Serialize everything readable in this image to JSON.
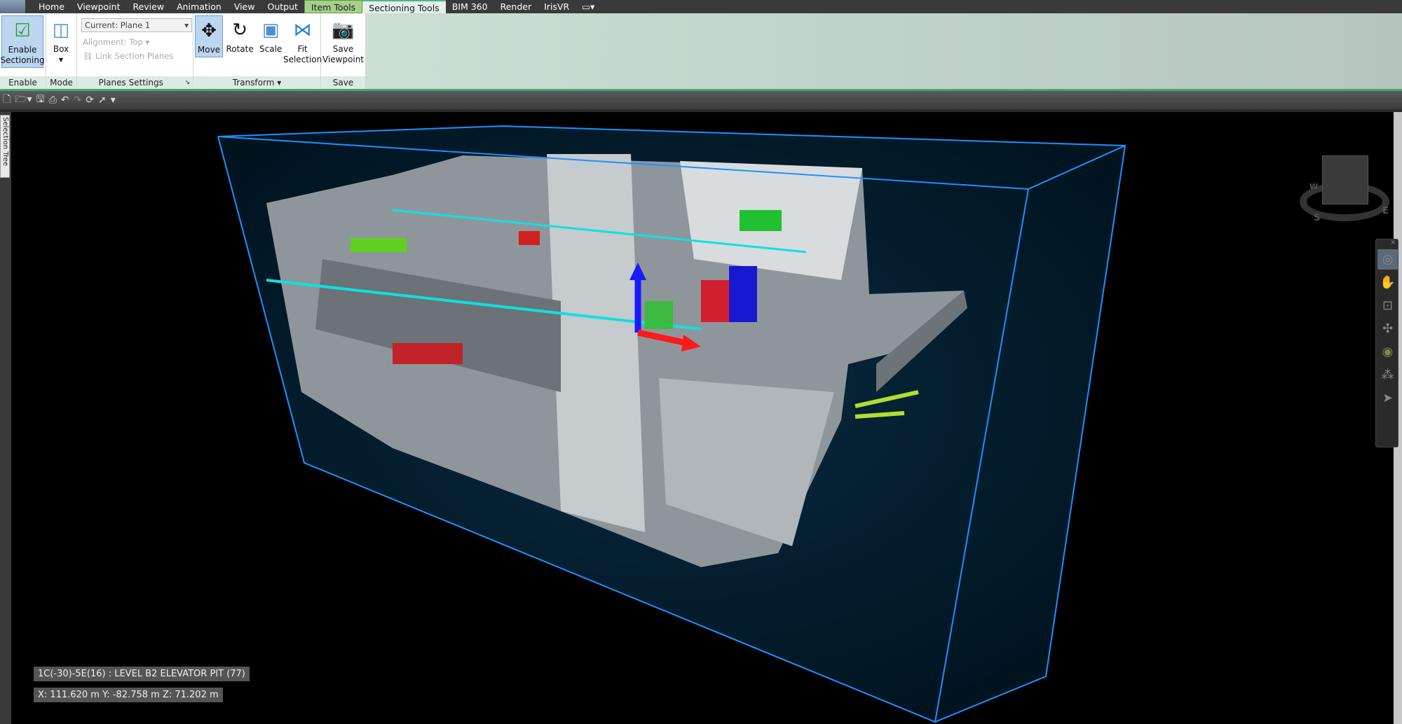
{
  "menu": {
    "tabs": [
      "Home",
      "Viewpoint",
      "Review",
      "Animation",
      "View",
      "Output",
      "Item Tools",
      "Sectioning Tools",
      "BIM 360",
      "Render",
      "IrisVR"
    ],
    "item_tools": "Item Tools",
    "active": "Sectioning Tools"
  },
  "ribbon": {
    "enable": {
      "button": "Enable Sectioning",
      "footer": "Enable"
    },
    "mode": {
      "button": "Box",
      "footer": "Mode"
    },
    "planes": {
      "current": "Current: Plane 1",
      "alignment": "Alignment: Top",
      "link": "Link Section Planes",
      "footer": "Planes Settings"
    },
    "transform": {
      "move": "Move",
      "rotate": "Rotate",
      "scale": "Scale",
      "fit": "Fit Selection",
      "footer": "Transform"
    },
    "save": {
      "button": "Save Viewpoint",
      "footer": "Save"
    }
  },
  "side_tab": "Selection Tree",
  "viewport": {
    "selection_label": "1C(-30)-5E(16) : LEVEL B2 ELEVATOR PIT (77)",
    "coordinates": "X: 111.620 m  Y: -82.758 m  Z: 71.202 m",
    "box_color": "#1e90ff",
    "background": "#001624"
  },
  "viewcube": {
    "labels": [
      "W",
      "S",
      "E"
    ]
  }
}
